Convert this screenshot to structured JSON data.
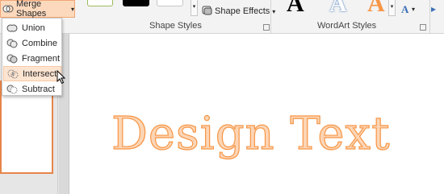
{
  "ribbon": {
    "merge_shapes_label": "Merge Shapes",
    "shape_effects_label": "Shape Effects",
    "shape_styles_group": "Shape Styles",
    "wordart_styles_group": "WordArt Styles",
    "wordart_sample": "A"
  },
  "merge_menu": {
    "items": [
      {
        "label": "Union",
        "icon": "union-icon"
      },
      {
        "label": "Combine",
        "icon": "combine-icon"
      },
      {
        "label": "Fragment",
        "icon": "fragment-icon"
      },
      {
        "label": "Intersect",
        "icon": "intersect-icon",
        "hovered": true
      },
      {
        "label": "Subtract",
        "icon": "subtract-icon"
      }
    ]
  },
  "slide": {
    "text": "Design Text"
  },
  "colors": {
    "accent_orange": "#f79646",
    "accent_light": "#fcd5b5",
    "hover_bg": "#fce4d1"
  }
}
